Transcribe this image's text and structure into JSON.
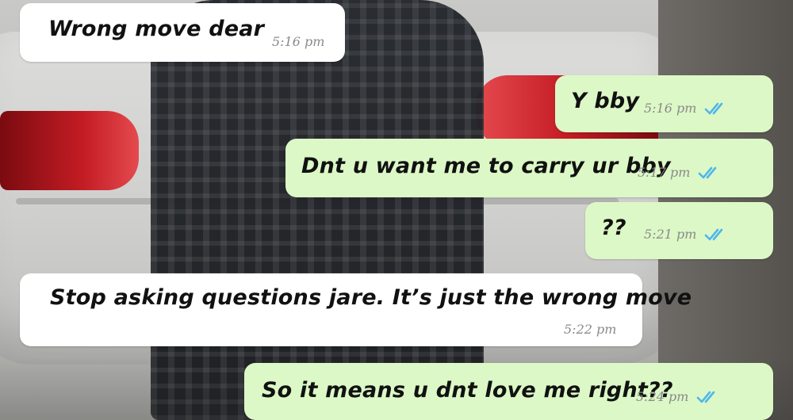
{
  "messages": [
    {
      "direction": "incoming",
      "text": "Wrong move dear",
      "time": "5:16 pm"
    },
    {
      "direction": "outgoing",
      "text": "Y bby",
      "time": "5:16 pm",
      "status": "read"
    },
    {
      "direction": "outgoing",
      "text": "Dnt u want me to carry ur bby",
      "time": "5:17 pm",
      "status": "read"
    },
    {
      "direction": "outgoing",
      "text": "??",
      "time": "5:21 pm",
      "status": "read"
    },
    {
      "direction": "incoming",
      "text": "Stop asking questions jare. It’s just the wrong move",
      "time": "5:22 pm"
    },
    {
      "direction": "outgoing",
      "text": "So it means u dnt love me right??",
      "time": "5:24 pm",
      "status": "read"
    }
  ],
  "colors": {
    "incoming_bubble": "#ffffff",
    "outgoing_bubble": "#dcf8c6",
    "read_tick": "#4fb6ec",
    "timestamp": "#8a8a8a"
  },
  "icons": {
    "read_receipt": "double-check-icon"
  }
}
